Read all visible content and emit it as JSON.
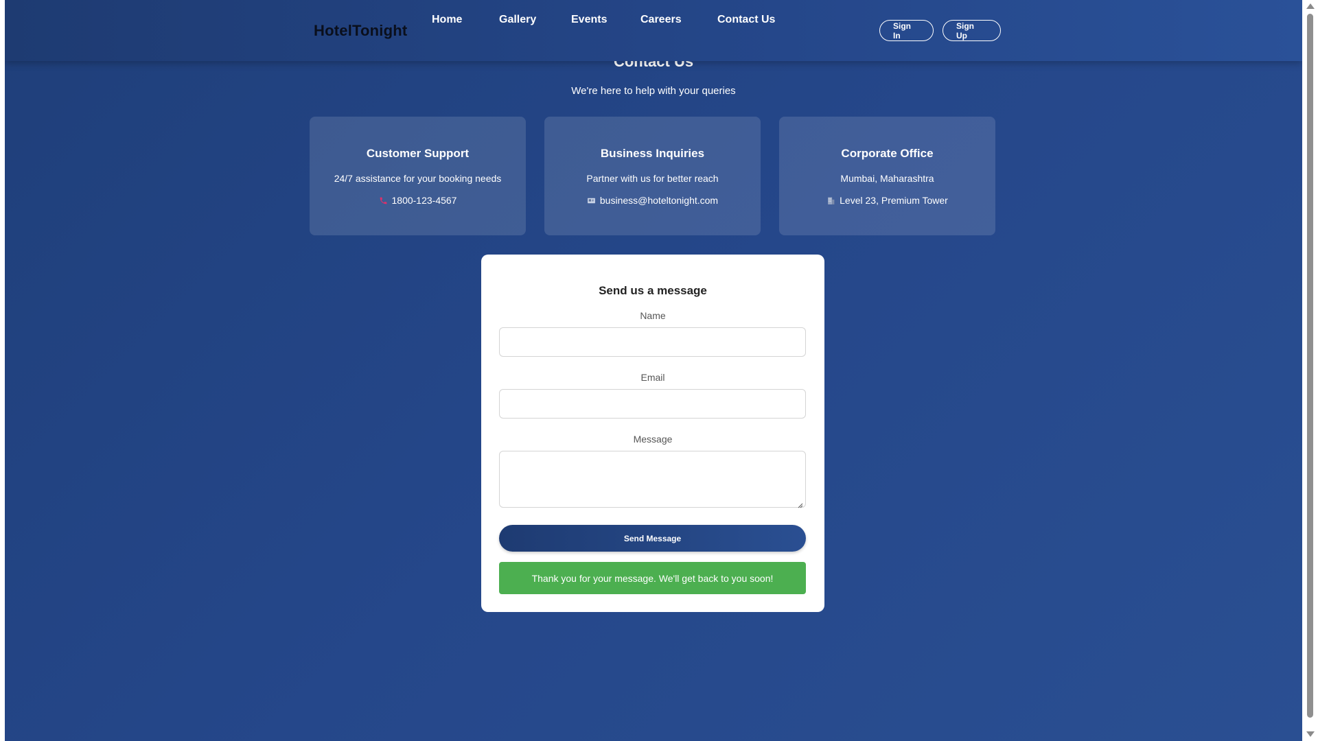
{
  "header": {
    "logo": "HotelTonight",
    "nav": [
      "Home",
      "Gallery",
      "Events",
      "Careers",
      "Contact Us"
    ],
    "sign_in": "Sign In",
    "sign_up": "Sign Up"
  },
  "hero": {
    "title": "Contact Us",
    "subtitle": "We're here to help with your queries"
  },
  "cards": [
    {
      "title": "Customer Support",
      "text": "24/7 assistance for your booking needs",
      "contact": "1800-123-4567",
      "icon": "phone-icon"
    },
    {
      "title": "Business Inquiries",
      "text": "Partner with us for better reach",
      "contact": "business@hoteltonight.com",
      "icon": "email-icon"
    },
    {
      "title": "Corporate Office",
      "text": "Mumbai, Maharashtra",
      "contact": "Level 23, Premium Tower",
      "icon": "building-icon"
    }
  ],
  "form": {
    "title": "Send us a message",
    "name_label": "Name",
    "name_value": "",
    "email_label": "Email",
    "email_value": "",
    "message_label": "Message",
    "message_value": "",
    "submit_label": "Send Message",
    "success_message": "Thank you for your message. We'll get back to you soon!"
  },
  "colors": {
    "background": "#25478a",
    "success": "#4caf50",
    "phone_icon": "#e0306a"
  }
}
